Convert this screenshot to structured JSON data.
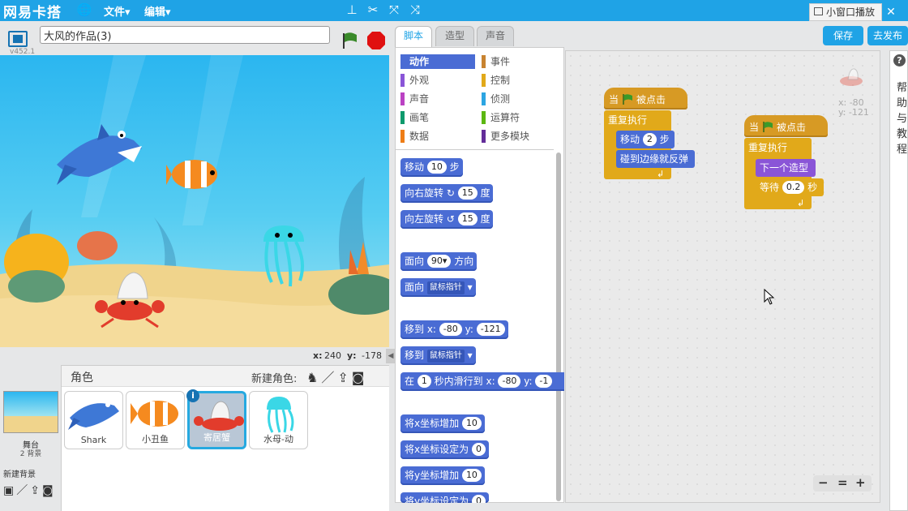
{
  "topbar": {
    "brand": "网易卡搭",
    "menus": [
      "文件▾",
      "编辑▾"
    ],
    "mini_play": "小窗口播放",
    "close": "✕"
  },
  "stage_header": {
    "project_name": "大风的作品(3)",
    "version": "v452.1"
  },
  "stage_footer": {
    "x_label": "x:",
    "x_value": "240",
    "y_label": "y:",
    "y_value": "-178"
  },
  "sprites": {
    "header": "角色",
    "new_sprite": "新建角色:",
    "stage_label": "舞台",
    "stage_count": "2 背景",
    "new_backdrop": "新建背景",
    "items": [
      {
        "name": "Shark"
      },
      {
        "name": "小丑鱼"
      },
      {
        "name": "寄居蟹",
        "selected": true
      },
      {
        "name": "水母-动"
      }
    ]
  },
  "tabs": [
    "脚本",
    "造型",
    "声音"
  ],
  "actions": {
    "save": "保存",
    "publish": "去发布"
  },
  "categories": [
    {
      "label": "动作",
      "color": "#4a6cd4",
      "active": true
    },
    {
      "label": "事件",
      "color": "#c88330"
    },
    {
      "label": "外观",
      "color": "#8a55d7"
    },
    {
      "label": "控制",
      "color": "#e1a91a"
    },
    {
      "label": "声音",
      "color": "#bb42c3"
    },
    {
      "label": "侦测",
      "color": "#2ca5e2"
    },
    {
      "label": "画笔",
      "color": "#0e9a6c"
    },
    {
      "label": "运算符",
      "color": "#5cb712"
    },
    {
      "label": "数据",
      "color": "#ee7d16"
    },
    {
      "label": "更多模块",
      "color": "#632d99"
    }
  ],
  "palette": {
    "move": "移动",
    "move_n": "10",
    "steps": "步",
    "turn_right": "向右旋转",
    "turn_right_n": "15",
    "deg": "度",
    "turn_left": "向左旋转",
    "turn_left_n": "15",
    "point_dir": "面向",
    "point_dir_n": "90▾",
    "dir": "方向",
    "point_to": "面向",
    "mouse_ptr": "鼠标指针",
    "goto_xy": "移到 x:",
    "goto_x": "-80",
    "y": "y:",
    "goto_y": "-121",
    "goto": "移到",
    "glide_in": "在",
    "glide_n": "1",
    "glide_text": "秒内滑行到 x:",
    "glide_x": "-80",
    "glide_y": "-1",
    "change_x": "将x坐标增加",
    "change_x_n": "10",
    "set_x": "将x坐标设定为",
    "set_x_n": "0",
    "change_y": "将y坐标增加",
    "change_y_n": "10",
    "set_y": "将y坐标设定为",
    "set_y_n": "0"
  },
  "script1": {
    "when": "当",
    "clicked": "被点击",
    "forever": "重复执行",
    "move": "移动",
    "move_n": "2",
    "steps": "步",
    "bounce": "碰到边缘就反弹"
  },
  "script2": {
    "when": "当",
    "clicked": "被点击",
    "forever": "重复执行",
    "next_costume": "下一个造型",
    "wait": "等待",
    "wait_n": "0.2",
    "sec": "秒"
  },
  "sprite_info": {
    "x": "x: -80",
    "y": "y: -121"
  },
  "help_text": [
    "帮",
    "助",
    "与",
    "教",
    "程"
  ],
  "zoom": [
    "−",
    "=",
    "+"
  ]
}
